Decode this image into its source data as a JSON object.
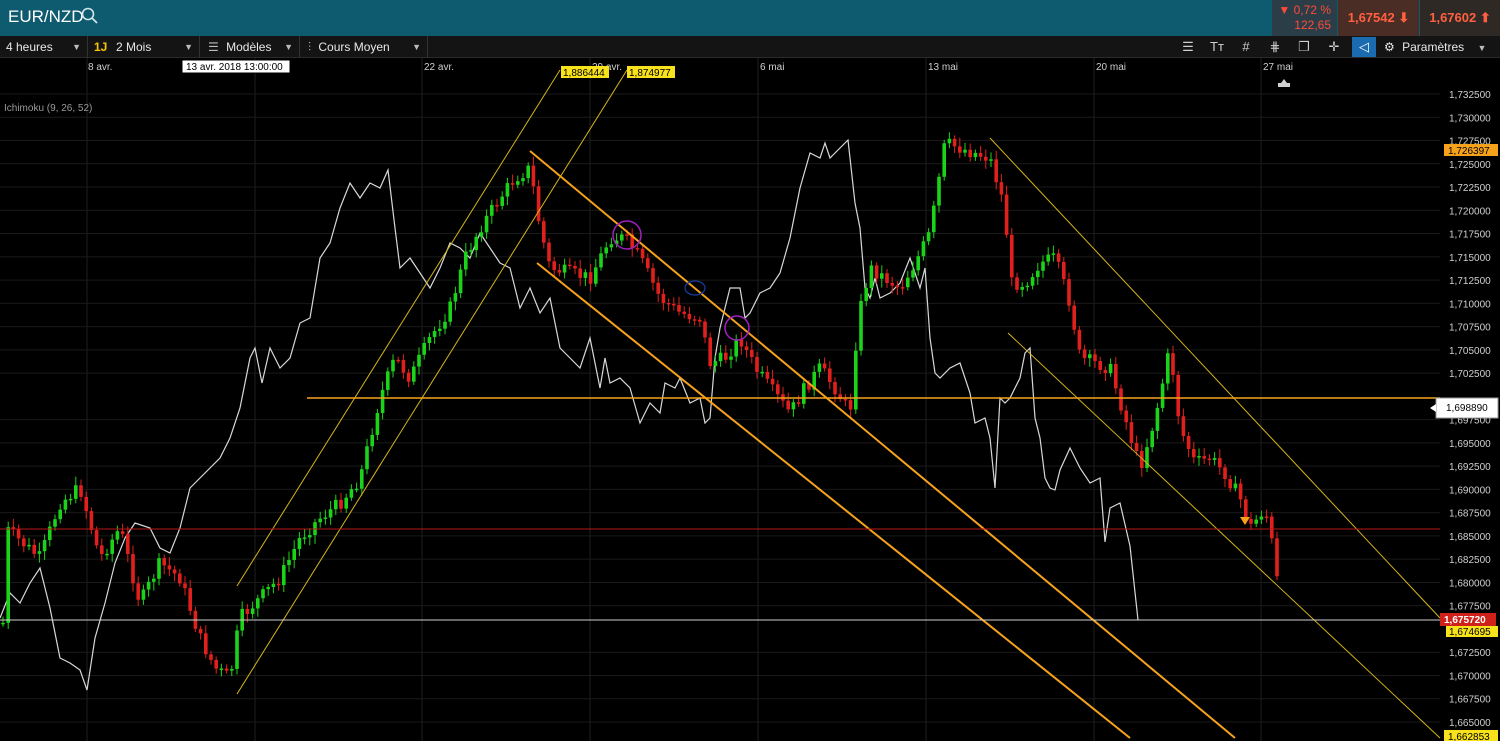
{
  "header": {
    "symbol": "EUR/NZD",
    "change_pct": "▼ 0,72 %",
    "change_pts": "122,65",
    "bid": "1,67542",
    "ask": "1,67602",
    "colors": {
      "bar": "#0e5a6e",
      "down": "#ff4a3a"
    }
  },
  "toolbar": {
    "timeframe": "4 heures",
    "badge": "1J",
    "period": "2 Mois",
    "templates": "Modèles",
    "chart_type": "Cours Moyen",
    "settings": "Paramètres",
    "icons": [
      "list-icon",
      "text-icon",
      "grid-icon",
      "drawing-tools-icon",
      "layers-icon",
      "crosshair-icon",
      "active-zoom-icon",
      "gear-icon"
    ]
  },
  "chart": {
    "indicator": "Ichimoku (9, 26, 52)",
    "crosshair_date": "13 avr. 2018 13:00:00",
    "x_labels": [
      "8 avr.",
      "22 avr.",
      "29 avr.",
      "6 mai",
      "13 mai",
      "20 mai",
      "27 mai"
    ],
    "channel_tags": [
      "1,886444",
      "1,874977"
    ],
    "y_labels": [
      "1,732500",
      "1,730000",
      "1,727500",
      "1,725000",
      "1,722500",
      "1,720000",
      "1,717500",
      "1,715000",
      "1,712500",
      "1,710000",
      "1,707500",
      "1,705000",
      "1,702500",
      "1,697500",
      "1,695000",
      "1,692500",
      "1,690000",
      "1,687500",
      "1,685000",
      "1,682500",
      "1,680000",
      "1,677500",
      "1,672500",
      "1,670000",
      "1,667500",
      "1,665000"
    ],
    "price_tags": {
      "upper": "1,726397",
      "hline": "1,698890",
      "last": "1,675720",
      "current": "1,674695",
      "bottom": "1,662853"
    },
    "colors": {
      "up": "#1bd318",
      "down": "#e0201d",
      "line": "#f7a21b",
      "channel": "#d4b41c",
      "tag_yellow": "#f7e21b",
      "tag_red": "#d0201a"
    }
  }
}
